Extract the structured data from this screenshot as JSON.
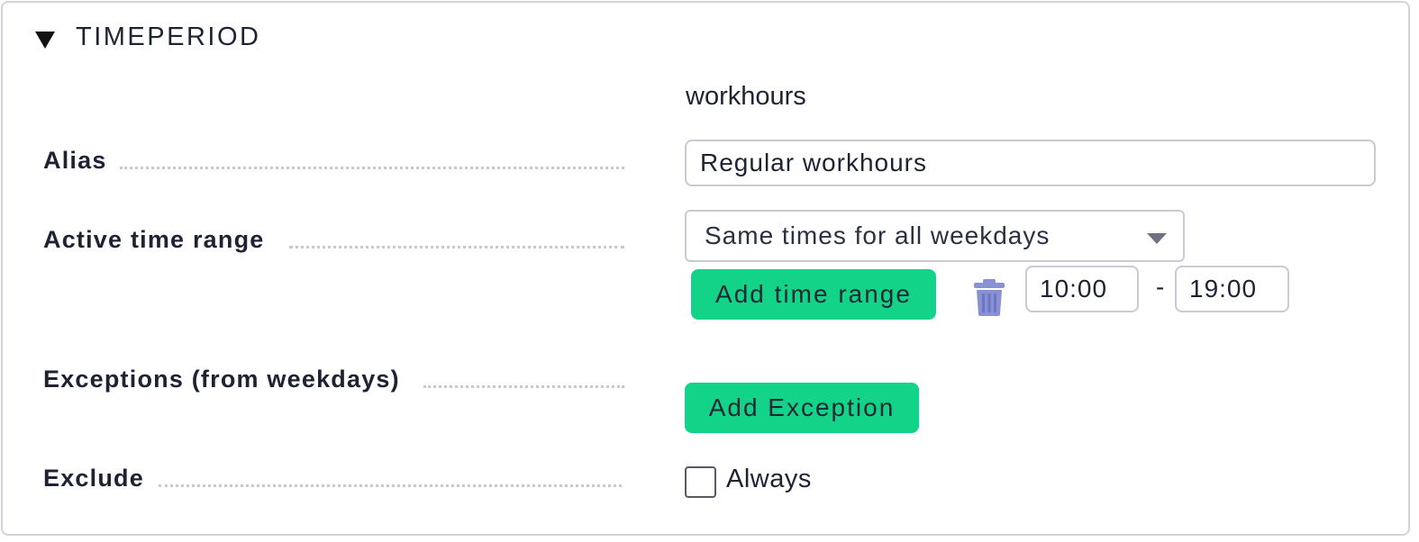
{
  "section": {
    "title": "TIMEPERIOD"
  },
  "fields": {
    "name_value": "workhours",
    "alias": {
      "label": "Alias",
      "value": "Regular workhours"
    },
    "active_time_range": {
      "label": "Active time range",
      "mode": "Same times for all weekdays",
      "add_button": "Add time range",
      "range_start": "10:00",
      "range_separator": "-",
      "range_end": "19:00"
    },
    "exceptions": {
      "label": "Exceptions (from weekdays)",
      "add_button": "Add Exception"
    },
    "exclude": {
      "label": "Exclude",
      "option": "Always",
      "checked": false
    }
  },
  "colors": {
    "accent_button": "#13d389",
    "trash_icon": "#8891d4",
    "border": "#c9cad3"
  },
  "icons": {
    "section_toggle": "triangle-down-icon",
    "delete_range": "trash-icon",
    "select_arrow": "chevron-down-icon"
  }
}
